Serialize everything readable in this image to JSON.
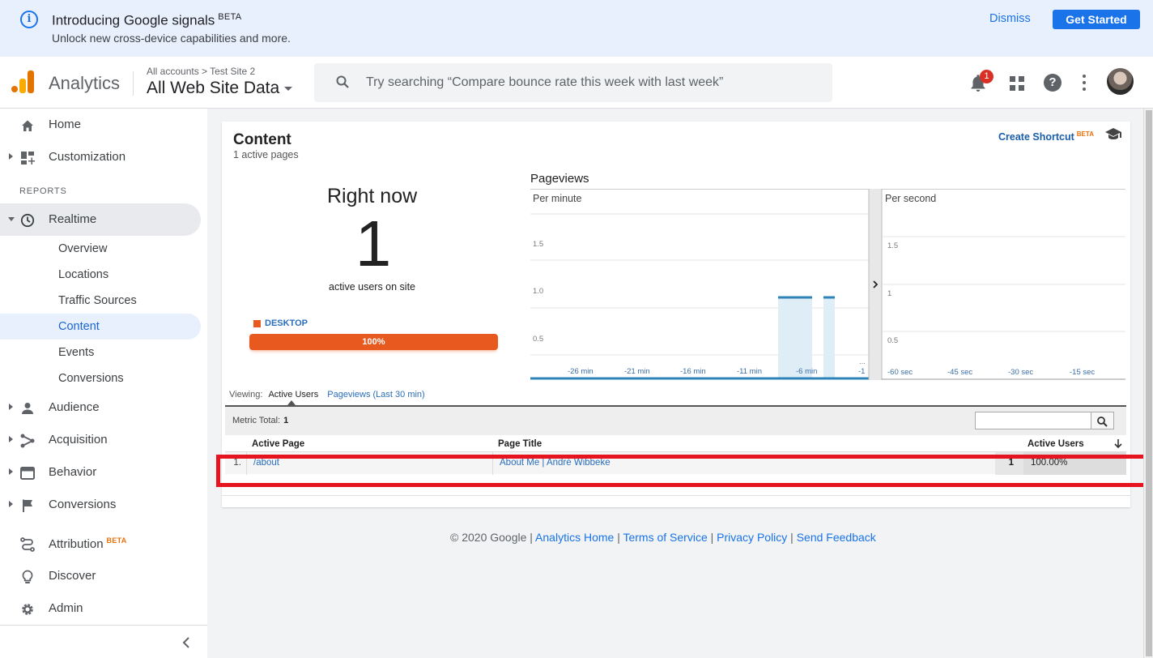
{
  "banner": {
    "title": "Introducing Google signals",
    "beta": "BETA",
    "subtitle": "Unlock new cross-device capabilities and more.",
    "dismiss": "Dismiss",
    "get_started": "Get Started",
    "icon": "info-icon"
  },
  "header": {
    "app_name": "Analytics",
    "breadcrumb": [
      "All accounts",
      "Test Site 2"
    ],
    "view": "All Web Site Data",
    "search_placeholder": "Try searching “Compare bounce rate this week with last week”",
    "notification_count": "1"
  },
  "sidebar": {
    "items": [
      {
        "label": "Home",
        "icon": "home-icon"
      },
      {
        "label": "Customization",
        "icon": "dashboard-icon"
      }
    ],
    "reports_label": "REPORTS",
    "realtime": {
      "label": "Realtime",
      "icon": "clock-icon",
      "sub": [
        "Overview",
        "Locations",
        "Traffic Sources",
        "Content",
        "Events",
        "Conversions"
      ],
      "selected": "Content"
    },
    "reports": [
      {
        "label": "Audience",
        "icon": "person-icon"
      },
      {
        "label": "Acquisition",
        "icon": "acquisition-icon"
      },
      {
        "label": "Behavior",
        "icon": "behavior-icon"
      },
      {
        "label": "Conversions",
        "icon": "flag-icon"
      }
    ],
    "bottom": [
      {
        "label": "Attribution",
        "beta": "BETA",
        "icon": "attribution-icon"
      },
      {
        "label": "Discover",
        "icon": "lightbulb-icon"
      },
      {
        "label": "Admin",
        "icon": "gear-icon"
      }
    ]
  },
  "content": {
    "title": "Content",
    "active_pages": "1 active pages",
    "create_shortcut": "Create Shortcut",
    "shortcut_beta": "BETA",
    "right_now": "Right now",
    "active_users": "1",
    "active_users_label": "active users on site",
    "device_legend": "DESKTOP",
    "device_share": "100%",
    "device_color": "#e8591f",
    "pageviews_title": "Pageviews",
    "viewing_label": "Viewing:",
    "tab_active_users": "Active Users",
    "tab_pageviews": "Pageviews (Last 30 min)",
    "metric_total_label": "Metric Total:",
    "metric_total": "1",
    "columns": [
      "Active Page",
      "Page Title",
      "Active Users"
    ],
    "rows": [
      {
        "index": "1.",
        "page": "/about",
        "title": "About Me | André Wibbeke",
        "users": "1",
        "share": "100.00%"
      }
    ]
  },
  "chart_data": [
    {
      "type": "bar",
      "title": "Per minute",
      "x_ticks": [
        "-26 min",
        "-21 min",
        "-16 min",
        "-11 min",
        "-6 min",
        "-1"
      ],
      "y_ticks": [
        "0.5",
        "1.0",
        "1.5"
      ],
      "ylim": [
        0,
        2
      ],
      "categories": [
        "-6 min",
        "-5 min",
        "-4 min",
        "-3 min",
        "-2 min"
      ],
      "values": [
        1,
        1,
        1,
        0,
        1
      ],
      "color": "#2e84b8"
    },
    {
      "type": "bar",
      "title": "Per second",
      "x_ticks": [
        "-60 sec",
        "-45 sec",
        "-30 sec",
        "-15 sec"
      ],
      "y_ticks": [
        "0.5",
        "1",
        "1.5"
      ],
      "ylim": [
        0,
        2
      ],
      "values": []
    }
  ],
  "footer": {
    "copyright": "© 2020 Google",
    "links": [
      "Analytics Home",
      "Terms of Service",
      "Privacy Policy",
      "Send Feedback"
    ]
  }
}
